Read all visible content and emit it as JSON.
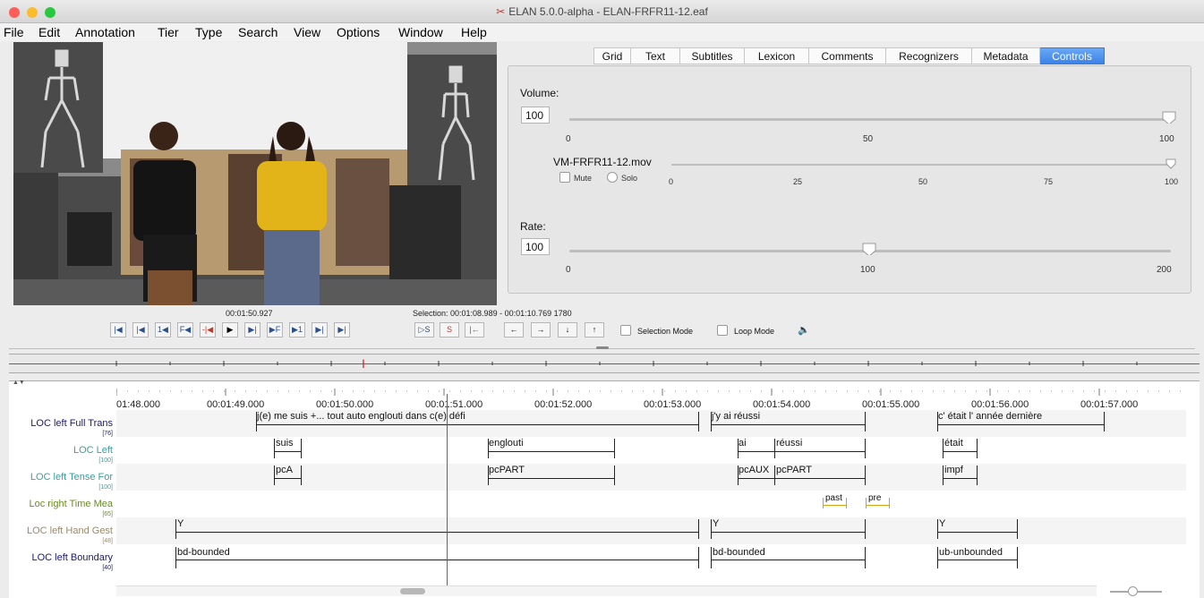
{
  "app": {
    "title": "ELAN 5.0.0-alpha - ELAN-FRFR11-12.eaf"
  },
  "menu": [
    "File",
    "Edit",
    "Annotation",
    "Tier",
    "Type",
    "Search",
    "View",
    "Options",
    "Window",
    "Help"
  ],
  "tabs": [
    "Grid",
    "Text",
    "Subtitles",
    "Lexicon",
    "Comments",
    "Recognizers",
    "Metadata",
    "Controls"
  ],
  "active_tab": "Controls",
  "controls": {
    "volume_label": "Volume:",
    "volume_value": "100",
    "volume_ticks": [
      "0",
      "50",
      "100"
    ],
    "volume_level": 100,
    "media_name": "VM-FRFR11-12.mov",
    "mute_label": "Mute",
    "solo_label": "Solo",
    "media_ticks": [
      "0",
      "25",
      "50",
      "75",
      "100"
    ],
    "media_level": 100,
    "rate_label": "Rate:",
    "rate_value": "100",
    "rate_ticks": [
      "0",
      "100",
      "200"
    ],
    "rate_level": 100
  },
  "player": {
    "current_time": "00:01:50.927",
    "selection": "Selection: 00:01:08.989 - 00:01:10.769  1780",
    "selection_mode_label": "Selection Mode",
    "loop_mode_label": "Loop Mode",
    "buttons": [
      "|◀",
      "|◀",
      "1◀",
      "F◀",
      "-|◀",
      "▶",
      "▶|",
      "▶F",
      "▶1",
      "▶|",
      "▶|"
    ],
    "sel_buttons": [
      "▷S",
      "S",
      "|←"
    ],
    "nav_buttons": [
      "←",
      "→",
      "↓",
      "↑"
    ]
  },
  "timeline": {
    "labels": [
      "01:48.000",
      "00:01:49.000",
      "00:01:50.000",
      "00:01:51.000",
      "00:01:52.000",
      "00:01:53.000",
      "00:01:54.000",
      "00:01:55.000",
      "00:01:56.000",
      "00:01:57.000"
    ]
  },
  "tiers": [
    {
      "name": "LOC left Full Trans",
      "count": "[76]",
      "color": "#1a1a6e"
    },
    {
      "name": "LOC Left",
      "count": "[100]",
      "color": "#3aa0a0"
    },
    {
      "name": "LOC left Tense For",
      "count": "[100]",
      "color": "#3aa0a0"
    },
    {
      "name": "Loc right Time Mea",
      "count": "[65]",
      "color": "#6a8a2a"
    },
    {
      "name": "LOC left Hand Gest",
      "count": "[48]",
      "color": "#9a8a6a"
    },
    {
      "name": "LOC left Boundary",
      "count": "[40]",
      "color": "#1a1a6e"
    }
  ],
  "annotations": {
    "full_trans": [
      "j(e) me suis +... tout auto englouti dans c(e) défi",
      "j'y ai réussi",
      "c' était l' année dernière"
    ],
    "loc_left": [
      "suis",
      "englouti",
      "ai",
      "réussi",
      "était"
    ],
    "tense": [
      "pcA",
      "pcPART",
      "pcAUX",
      "pcPART",
      "impf"
    ],
    "time": [
      "past",
      "pre"
    ],
    "hand": [
      "Y",
      "Y",
      "Y"
    ],
    "boundary": [
      "bd-bounded",
      "bd-bounded",
      "ub-unbounded"
    ]
  }
}
